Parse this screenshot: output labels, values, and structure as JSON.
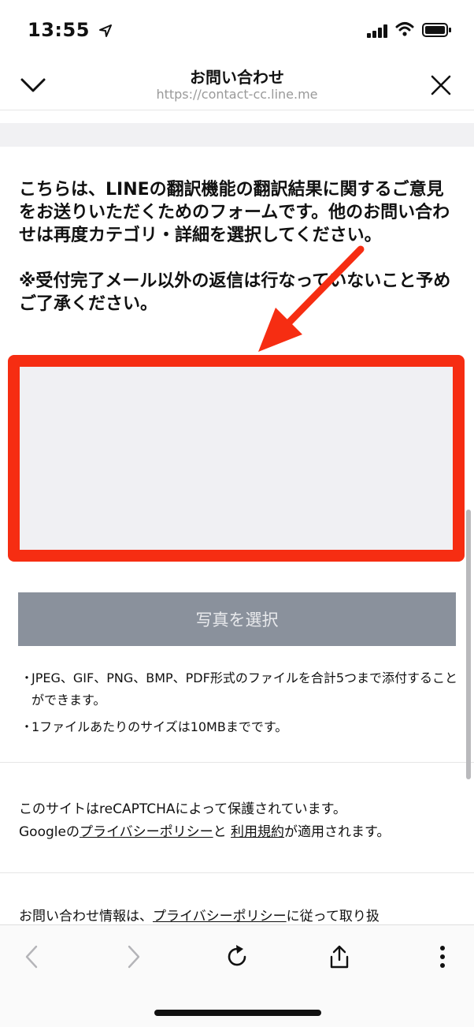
{
  "status_bar": {
    "time": "13:55",
    "location_icon": "location-arrow-icon"
  },
  "header": {
    "title": "お問い合わせ",
    "url": "https://contact-cc.line.me",
    "left_icon": "chevron-down-icon",
    "right_icon": "close-icon"
  },
  "intro": {
    "paragraph1": "こちらは、LINEの翻訳機能の翻訳結果に関するご意見をお送りいただくためのフォームです。他のお問い合わせは再度カテゴリ・詳細を選択してください。",
    "paragraph2": "※受付完了メール以外の返信は行なっていないこと予めご了承ください。"
  },
  "annotation": {
    "color": "#f62d12"
  },
  "photo_button": {
    "label": "写真を選択"
  },
  "notes": [
    "JPEG、GIF、PNG、BMP、PDF形式のファイルを合計5つまで添付することができます。",
    "1ファイルあたりのサイズは10MBまでです。"
  ],
  "notes_bullet": "・",
  "recaptcha": {
    "line1": "このサイトはreCAPTCHAによって保護されています。",
    "google": "Googleの",
    "privacy_link": "プライバシーポリシー",
    "and": "と",
    "terms_link": "利用規約",
    "applies": "が適用されます。"
  },
  "footer_text": {
    "prefix": "お問い合わせ情報は、",
    "privacy_link": "プライバシーポリシー",
    "suffix": "に従って取り扱"
  },
  "toolbar": {
    "back_icon": "back-icon",
    "forward_icon": "forward-icon",
    "reload_icon": "reload-icon",
    "share_icon": "share-icon",
    "more_icon": "more-icon"
  }
}
